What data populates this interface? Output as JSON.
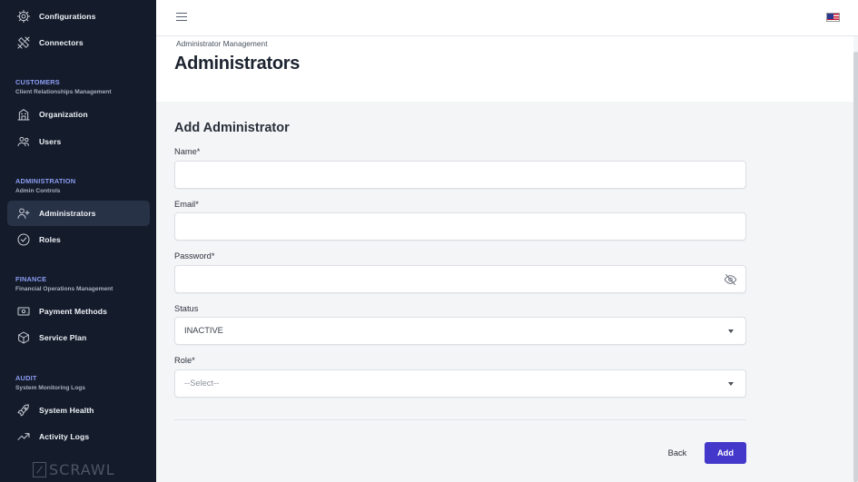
{
  "sidebar": {
    "top_items": [
      {
        "label": "Configurations",
        "icon": "gear-icon"
      },
      {
        "label": "Connectors",
        "icon": "tools-icon"
      }
    ],
    "sections": [
      {
        "title": "CUSTOMERS",
        "subtitle": "Client Relationships Management",
        "items": [
          {
            "label": "Organization",
            "icon": "building-icon"
          },
          {
            "label": "Users",
            "icon": "users-icon"
          }
        ]
      },
      {
        "title": "ADMINISTRATION",
        "subtitle": "Admin Controls",
        "items": [
          {
            "label": "Administrators",
            "icon": "user-plus-icon",
            "active": true
          },
          {
            "label": "Roles",
            "icon": "check-circle-icon"
          }
        ]
      },
      {
        "title": "FINANCE",
        "subtitle": "Financial Operations Management",
        "items": [
          {
            "label": "Payment Methods",
            "icon": "banknote-icon"
          },
          {
            "label": "Service Plan",
            "icon": "box-icon"
          }
        ]
      },
      {
        "title": "AUDIT",
        "subtitle": "System Monitoring Logs",
        "items": [
          {
            "label": "System Health",
            "icon": "rocket-icon"
          },
          {
            "label": "Activity Logs",
            "icon": "trending-up-icon"
          }
        ]
      }
    ],
    "logo_text": "SCRAWL"
  },
  "topbar": {
    "menu_icon": "hamburger-icon",
    "language_flag": "us-flag-icon"
  },
  "header": {
    "breadcrumb": "Administrator Management",
    "title": "Administrators"
  },
  "form": {
    "title": "Add Administrator",
    "name": {
      "label": "Name*",
      "value": ""
    },
    "email": {
      "label": "Email*",
      "value": ""
    },
    "password": {
      "label": "Password*",
      "value": "",
      "toggle_icon": "eye-off-icon"
    },
    "status": {
      "label": "Status",
      "value": "INACTIVE"
    },
    "role": {
      "label": "Role*",
      "placeholder": "--Select--"
    },
    "back_label": "Back",
    "add_label": "Add"
  },
  "colors": {
    "sidebar_bg": "#141c2b",
    "active_item_bg": "#283246",
    "section_title": "#8b9cf2",
    "primary_button": "#4338ca"
  }
}
